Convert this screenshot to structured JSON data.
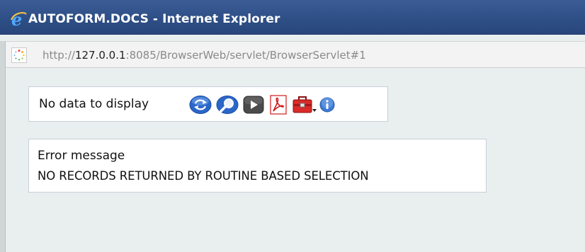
{
  "window": {
    "title": "AUTOFORM.DOCS - Internet Explorer"
  },
  "address": {
    "scheme": "http://",
    "host": "127.0.0.1",
    "rest": ":8085/BrowserWeb/servlet/BrowserServlet#1"
  },
  "toolbar": {
    "label": "No data to display",
    "buttons": [
      {
        "icon": "refresh-icon"
      },
      {
        "icon": "search-icon"
      },
      {
        "icon": "play-icon"
      },
      {
        "icon": "pdf-icon"
      },
      {
        "icon": "toolbox-dropdown-icon"
      },
      {
        "icon": "info-icon"
      }
    ]
  },
  "error": {
    "title": "Error message",
    "message": "NO RECORDS RETURNED BY ROUTINE BASED SELECTION"
  },
  "colors": {
    "titlebar": "#2e4f86",
    "content_bg": "#e9efee",
    "accent_blue": "#2b66c9",
    "pdf_red": "#d21a1a"
  }
}
